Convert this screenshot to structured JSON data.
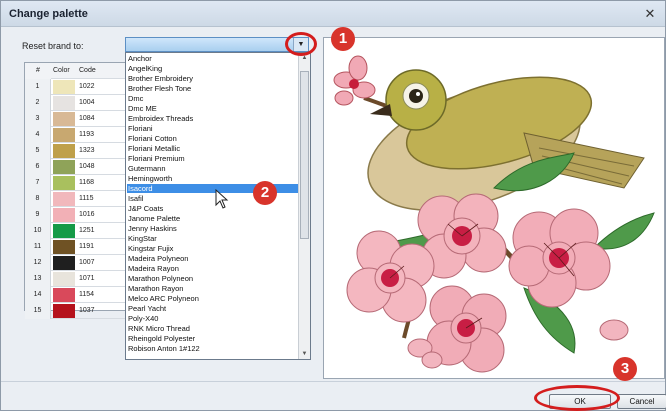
{
  "window": {
    "title": "Change palette",
    "close_glyph": "✕"
  },
  "reset": {
    "label": "Reset brand to:",
    "value": ""
  },
  "palette": {
    "headers": [
      "#",
      "Color",
      "Code"
    ],
    "rows": [
      {
        "num": "1",
        "color": "#eee6b9",
        "code": "1022"
      },
      {
        "num": "2",
        "color": "#e6e3e1",
        "code": "1004"
      },
      {
        "num": "3",
        "color": "#d8b996",
        "code": "1084"
      },
      {
        "num": "4",
        "color": "#c8a870",
        "code": "1193"
      },
      {
        "num": "5",
        "color": "#bfa04a",
        "code": "1323"
      },
      {
        "num": "6",
        "color": "#8fa359",
        "code": "1048"
      },
      {
        "num": "7",
        "color": "#a9c05e",
        "code": "1168"
      },
      {
        "num": "8",
        "color": "#f1b8bc",
        "code": "1115"
      },
      {
        "num": "9",
        "color": "#f2b0b6",
        "code": "1016"
      },
      {
        "num": "10",
        "color": "#159a47",
        "code": "1251"
      },
      {
        "num": "11",
        "color": "#6f5224",
        "code": "1191"
      },
      {
        "num": "12",
        "color": "#1f1f1f",
        "code": "1007"
      },
      {
        "num": "13",
        "color": "#e8e4dc",
        "code": "1071"
      },
      {
        "num": "14",
        "color": "#d9495b",
        "code": "1154"
      },
      {
        "num": "15",
        "color": "#b5121c",
        "code": "1037"
      }
    ]
  },
  "brands": [
    "Anchor",
    "AngelKing",
    "Brother Embroidery",
    "Brother Flesh Tone",
    "Dmc",
    "Dmc ME",
    "Embroidex Threads",
    "Floriani",
    "Floriani Cotton",
    "Floriani Metallic",
    "Floriani Premium",
    "Gutermann",
    "Hemingworth",
    "Isacord",
    "Isafil",
    "J&P Coats",
    "Janome Palette",
    "Jenny Haskins",
    "KingStar",
    "Kingstar Fujix",
    "Madeira Polyneon",
    "Madeira Rayon",
    "Marathon Polyneon",
    "Marathon Rayon",
    "Melco ARC Polyneon",
    "Pearl Yacht",
    "Poly-X40",
    "RNK Micro Thread",
    "Rheingold Polyester",
    "Robison Anton 1#122"
  ],
  "selected_brand_index": 13,
  "buttons": {
    "ok": "OK",
    "cancel": "Cancel"
  },
  "callouts": [
    "1",
    "2",
    "3"
  ],
  "colors": {
    "accent": "#d8342b",
    "selection": "#3d8ee6"
  }
}
